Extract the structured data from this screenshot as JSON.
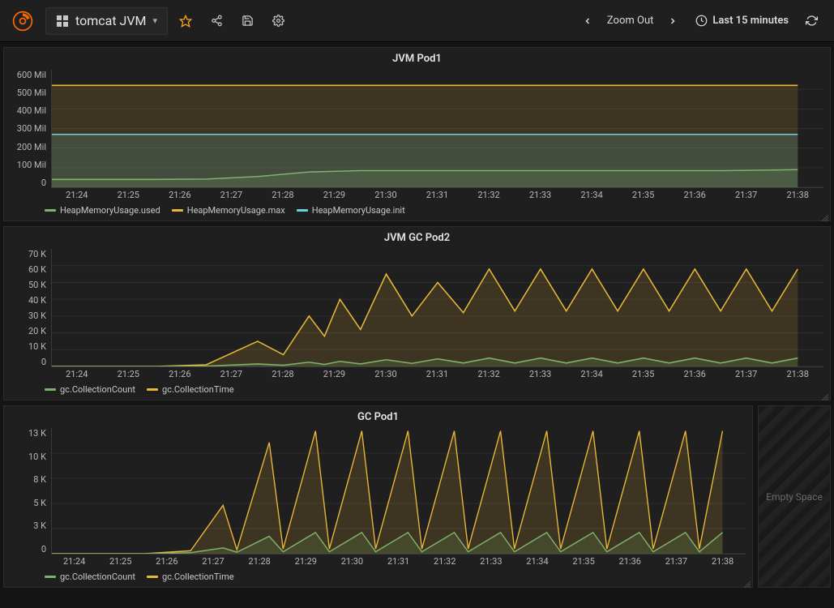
{
  "header": {
    "dashboard_title": "tomcat JVM",
    "zoom_label": "Zoom Out",
    "time_range_label": "Last 15 minutes"
  },
  "colors": {
    "green": "#7eb26d",
    "yellow": "#eab839",
    "cyan": "#6ed0e0"
  },
  "x_ticks": [
    "21:24",
    "21:25",
    "21:26",
    "21:27",
    "21:28",
    "21:29",
    "21:30",
    "21:31",
    "21:32",
    "21:33",
    "21:34",
    "21:35",
    "21:36",
    "21:37",
    "21:38"
  ],
  "empty_label": "Empty Space",
  "panels": [
    {
      "id": "jvm-pod1",
      "title": "JVM Pod1",
      "height": 150,
      "y_ticks": [
        "600 Mil",
        "500 Mil",
        "400 Mil",
        "300 Mil",
        "200 Mil",
        "100 Mil",
        "0"
      ],
      "legend": [
        {
          "label": "HeapMemoryUsage.used",
          "color": "#7eb26d"
        },
        {
          "label": "HeapMemoryUsage.max",
          "color": "#eab839"
        },
        {
          "label": "HeapMemoryUsage.init",
          "color": "#6ed0e0"
        }
      ]
    },
    {
      "id": "jvm-gc-pod2",
      "title": "JVM GC Pod2",
      "height": 150,
      "y_ticks": [
        "70 K",
        "60 K",
        "50 K",
        "40 K",
        "30 K",
        "20 K",
        "10 K",
        "0"
      ],
      "legend": [
        {
          "label": "gc.CollectionCount",
          "color": "#7eb26d"
        },
        {
          "label": "gc.CollectionTime",
          "color": "#eab839"
        }
      ]
    },
    {
      "id": "gc-pod1",
      "title": "GC Pod1",
      "height": 160,
      "y_ticks": [
        "13 K",
        "10 K",
        "8 K",
        "5 K",
        "3 K",
        "0"
      ],
      "legend": [
        {
          "label": "gc.CollectionCount",
          "color": "#7eb26d"
        },
        {
          "label": "gc.CollectionTime",
          "color": "#eab839"
        }
      ]
    }
  ],
  "chart_data": [
    {
      "id": "jvm-pod1",
      "type": "area",
      "title": "JVM Pod1",
      "xlabel": "",
      "ylabel": "",
      "x": [
        "21:23",
        "21:24",
        "21:25",
        "21:26",
        "21:27",
        "21:28",
        "21:29",
        "21:30",
        "21:31",
        "21:32",
        "21:33",
        "21:34",
        "21:35",
        "21:36",
        "21:37",
        "21:37.5"
      ],
      "ylim": [
        0,
        600000000
      ],
      "series": [
        {
          "name": "HeapMemoryUsage.max",
          "color": "#eab839",
          "values": [
            520000000,
            520000000,
            520000000,
            520000000,
            520000000,
            520000000,
            520000000,
            520000000,
            520000000,
            520000000,
            520000000,
            520000000,
            520000000,
            520000000,
            520000000,
            520000000
          ]
        },
        {
          "name": "HeapMemoryUsage.init",
          "color": "#6ed0e0",
          "values": [
            270000000,
            270000000,
            270000000,
            270000000,
            270000000,
            270000000,
            270000000,
            270000000,
            270000000,
            270000000,
            270000000,
            270000000,
            270000000,
            270000000,
            270000000,
            270000000
          ]
        },
        {
          "name": "HeapMemoryUsage.used",
          "color": "#7eb26d",
          "values": [
            40000000,
            40000000,
            40000000,
            42000000,
            55000000,
            78000000,
            85000000,
            85000000,
            85000000,
            85000000,
            85000000,
            85000000,
            85000000,
            85000000,
            88000000,
            90000000
          ]
        }
      ]
    },
    {
      "id": "jvm-gc-pod2",
      "type": "area",
      "title": "JVM GC Pod2",
      "xlabel": "",
      "ylabel": "",
      "x": [
        "21:23",
        "21:24",
        "21:25",
        "21:26",
        "21:27",
        "21:27.5",
        "21:28",
        "21:28.3",
        "21:28.6",
        "21:29",
        "21:29.5",
        "21:30",
        "21:30.5",
        "21:31",
        "21:31.5",
        "21:32",
        "21:32.5",
        "21:33",
        "21:33.5",
        "21:34",
        "21:34.5",
        "21:35",
        "21:35.5",
        "21:36",
        "21:36.5",
        "21:37",
        "21:37.5"
      ],
      "ylim": [
        0,
        70000
      ],
      "series": [
        {
          "name": "gc.CollectionTime",
          "color": "#eab839",
          "values": [
            0,
            0,
            0,
            1000,
            15000,
            7000,
            30000,
            18000,
            40000,
            22000,
            55000,
            30000,
            50000,
            32000,
            58000,
            33000,
            58000,
            33000,
            58000,
            33000,
            58000,
            33000,
            58000,
            33000,
            58000,
            33000,
            58000
          ]
        },
        {
          "name": "gc.CollectionCount",
          "color": "#7eb26d",
          "values": [
            0,
            0,
            0,
            200,
            1500,
            700,
            2500,
            1200,
            3000,
            1500,
            4000,
            1800,
            4500,
            2000,
            5000,
            2000,
            5000,
            2000,
            5000,
            2000,
            5000,
            2000,
            5000,
            2000,
            5000,
            2000,
            5000
          ]
        }
      ]
    },
    {
      "id": "gc-pod1",
      "type": "area",
      "title": "GC Pod1",
      "xlabel": "",
      "ylabel": "",
      "x": [
        "21:23",
        "21:24",
        "21:25",
        "21:26",
        "21:26.7",
        "21:27",
        "21:27.7",
        "21:28",
        "21:28.7",
        "21:29",
        "21:29.7",
        "21:30",
        "21:30.7",
        "21:31",
        "21:31.7",
        "21:32",
        "21:32.7",
        "21:33",
        "21:33.7",
        "21:34",
        "21:34.7",
        "21:35",
        "21:35.7",
        "21:36",
        "21:36.7",
        "21:37",
        "21:37.5"
      ],
      "ylim": [
        0,
        13000
      ],
      "series": [
        {
          "name": "gc.CollectionTime",
          "color": "#eab839",
          "values": [
            0,
            0,
            0,
            300,
            5000,
            400,
            11500,
            500,
            12700,
            500,
            12700,
            500,
            12700,
            500,
            12700,
            500,
            12700,
            500,
            12700,
            500,
            12700,
            500,
            12700,
            500,
            12700,
            500,
            12700
          ]
        },
        {
          "name": "gc.CollectionCount",
          "color": "#7eb26d",
          "values": [
            0,
            0,
            0,
            100,
            600,
            150,
            1800,
            200,
            2200,
            200,
            2200,
            200,
            2200,
            200,
            2200,
            200,
            2200,
            200,
            2200,
            200,
            2200,
            200,
            2200,
            200,
            2200,
            200,
            2200
          ]
        }
      ]
    }
  ]
}
